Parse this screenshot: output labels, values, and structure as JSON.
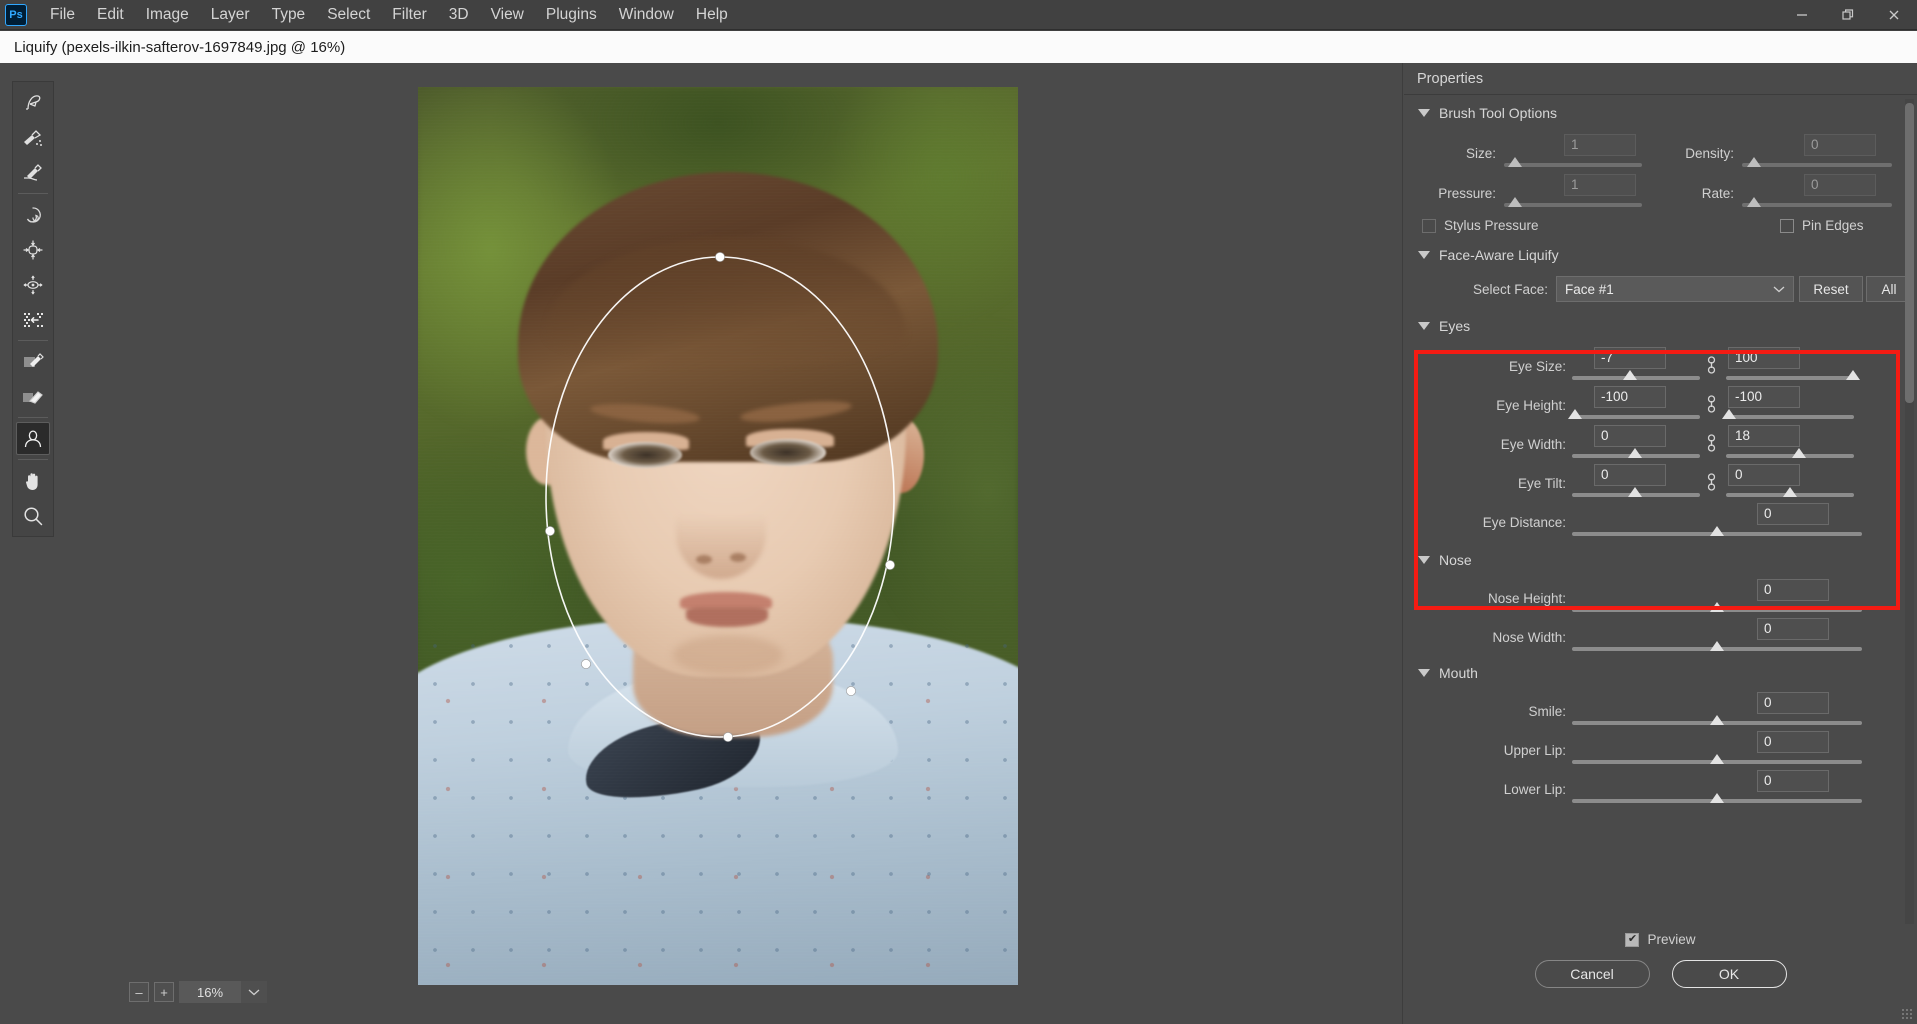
{
  "menubar": {
    "logo": "Ps",
    "items": [
      "File",
      "Edit",
      "Image",
      "Layer",
      "Type",
      "Select",
      "Filter",
      "3D",
      "View",
      "Plugins",
      "Window",
      "Help"
    ],
    "window_controls": {
      "minimize": "–",
      "restore": "❐",
      "close": "✕"
    }
  },
  "dialog": {
    "title": "Liquify (pexels-ilkin-safterov-1697849.jpg @ 16%)"
  },
  "toolbar": {
    "tools": [
      {
        "name": "forward-warp-tool",
        "label": "Forward Warp Tool",
        "active": false
      },
      {
        "name": "reconstruct-tool",
        "label": "Reconstruct Tool",
        "active": false
      },
      {
        "name": "smooth-tool",
        "label": "Smooth Tool",
        "active": false
      },
      {
        "name": "twirl-clockwise-tool",
        "label": "Twirl Clockwise Tool",
        "active": false
      },
      {
        "name": "pucker-tool",
        "label": "Pucker Tool",
        "active": false
      },
      {
        "name": "bloat-tool",
        "label": "Bloat Tool",
        "active": false
      },
      {
        "name": "push-left-tool",
        "label": "Push Left Tool",
        "active": false
      },
      {
        "name": "freeze-mask-tool",
        "label": "Freeze Mask Tool",
        "active": false
      },
      {
        "name": "thaw-mask-tool",
        "label": "Thaw Mask Tool",
        "active": false
      },
      {
        "name": "face-tool",
        "label": "Face Tool",
        "active": true
      },
      {
        "name": "hand-tool",
        "label": "Hand Tool",
        "active": false
      },
      {
        "name": "zoom-tool",
        "label": "Zoom Tool",
        "active": false
      }
    ]
  },
  "canvas": {
    "zoom_level": "16%",
    "zoom_out_label": "–",
    "zoom_in_label": "+",
    "zoom_dropdown_icon": "chevron-down-icon",
    "face_overlay_label": "face-outline-oval"
  },
  "properties": {
    "header": "Properties",
    "brush_tool_options": {
      "title": "Brush Tool Options",
      "fields": [
        {
          "label": "Size:",
          "value": "1",
          "thumb_pct": 8,
          "disabled": true
        },
        {
          "label": "Density:",
          "value": "0",
          "thumb_pct": 8,
          "disabled": true
        },
        {
          "label": "Pressure:",
          "value": "1",
          "thumb_pct": 8,
          "disabled": true
        },
        {
          "label": "Rate:",
          "value": "0",
          "thumb_pct": 8,
          "disabled": true
        }
      ],
      "stylus_pressure": {
        "label": "Stylus Pressure",
        "checked": false,
        "disabled": true
      },
      "pin_edges": {
        "label": "Pin Edges",
        "checked": false,
        "disabled": false
      }
    },
    "face_aware_liquify": {
      "title": "Face-Aware Liquify",
      "select_face_label": "Select Face:",
      "select_face_value": "Face #1",
      "reset_label": "Reset",
      "all_label": "All"
    },
    "eyes": {
      "title": "Eyes",
      "highlighted": true,
      "rows": [
        {
          "label": "Eye Size:",
          "left": "-7",
          "right": "100",
          "left_pct": 45,
          "right_pct": 99,
          "paired": true
        },
        {
          "label": "Eye Height:",
          "left": "-100",
          "right": "-100",
          "left_pct": 2,
          "right_pct": 2,
          "paired": true
        },
        {
          "label": "Eye Width:",
          "left": "0",
          "right": "18",
          "left_pct": 49,
          "right_pct": 57,
          "paired": true
        },
        {
          "label": "Eye Tilt:",
          "left": "0",
          "right": "0",
          "left_pct": 49,
          "right_pct": 50,
          "paired": true
        },
        {
          "label": "Eye Distance:",
          "left": null,
          "right": "0",
          "left_pct": null,
          "right_pct": 50,
          "paired": false
        }
      ]
    },
    "nose": {
      "title": "Nose",
      "rows": [
        {
          "label": "Nose Height:",
          "value": "0",
          "thumb_pct": 50
        },
        {
          "label": "Nose Width:",
          "value": "0",
          "thumb_pct": 50
        }
      ]
    },
    "mouth": {
      "title": "Mouth",
      "rows": [
        {
          "label": "Smile:",
          "value": "0",
          "thumb_pct": 50
        },
        {
          "label": "Upper Lip:",
          "value": "0",
          "thumb_pct": 50
        },
        {
          "label": "Lower Lip:",
          "value": "0",
          "thumb_pct": 50
        }
      ]
    },
    "scroll_chevron": "chevron-down-icon"
  },
  "footer": {
    "preview": {
      "label": "Preview",
      "checked": true
    },
    "cancel_label": "Cancel",
    "ok_label": "OK"
  },
  "colors": {
    "annotation_red": "#f41b13",
    "panel_bg": "#4a4a4a",
    "text": "#d4d4d4"
  }
}
